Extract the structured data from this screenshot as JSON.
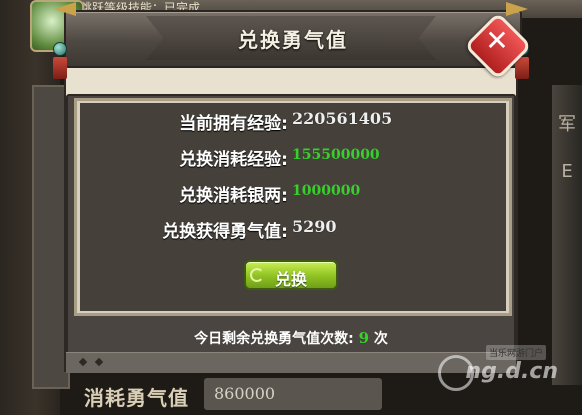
{
  "background": {
    "top_banner_text": "跳跃等级技能：已完成",
    "right_panel_chars": [
      "军",
      "E"
    ],
    "bottom_label": "消耗勇气值",
    "bottom_value": "860000",
    "watermark_small": "当乐网游门户",
    "watermark_big": "ng.d.cn"
  },
  "dialog": {
    "title": "兑换勇气值",
    "close_symbol": "✕",
    "rows": [
      {
        "label": "当前拥有经验:",
        "value": "220561405"
      },
      {
        "label": "兑换消耗经验:",
        "value": "155500000"
      },
      {
        "label": "兑换消耗银两:",
        "value": "1000000"
      },
      {
        "label": "兑换获得勇气值:",
        "value": "5290"
      }
    ],
    "exchange_button": "兑换",
    "remaining_prefix": "今日剩余兑换勇气值次数:",
    "remaining_count": "9",
    "remaining_suffix": "次"
  },
  "colors": {
    "accent_green": "#36d12b",
    "button_green": "#8fc122",
    "close_red": "#d93434"
  },
  "icons": [
    "close-icon",
    "refresh-icon",
    "lantern-icon",
    "arrow-left-icon",
    "arrow-right-icon"
  ]
}
